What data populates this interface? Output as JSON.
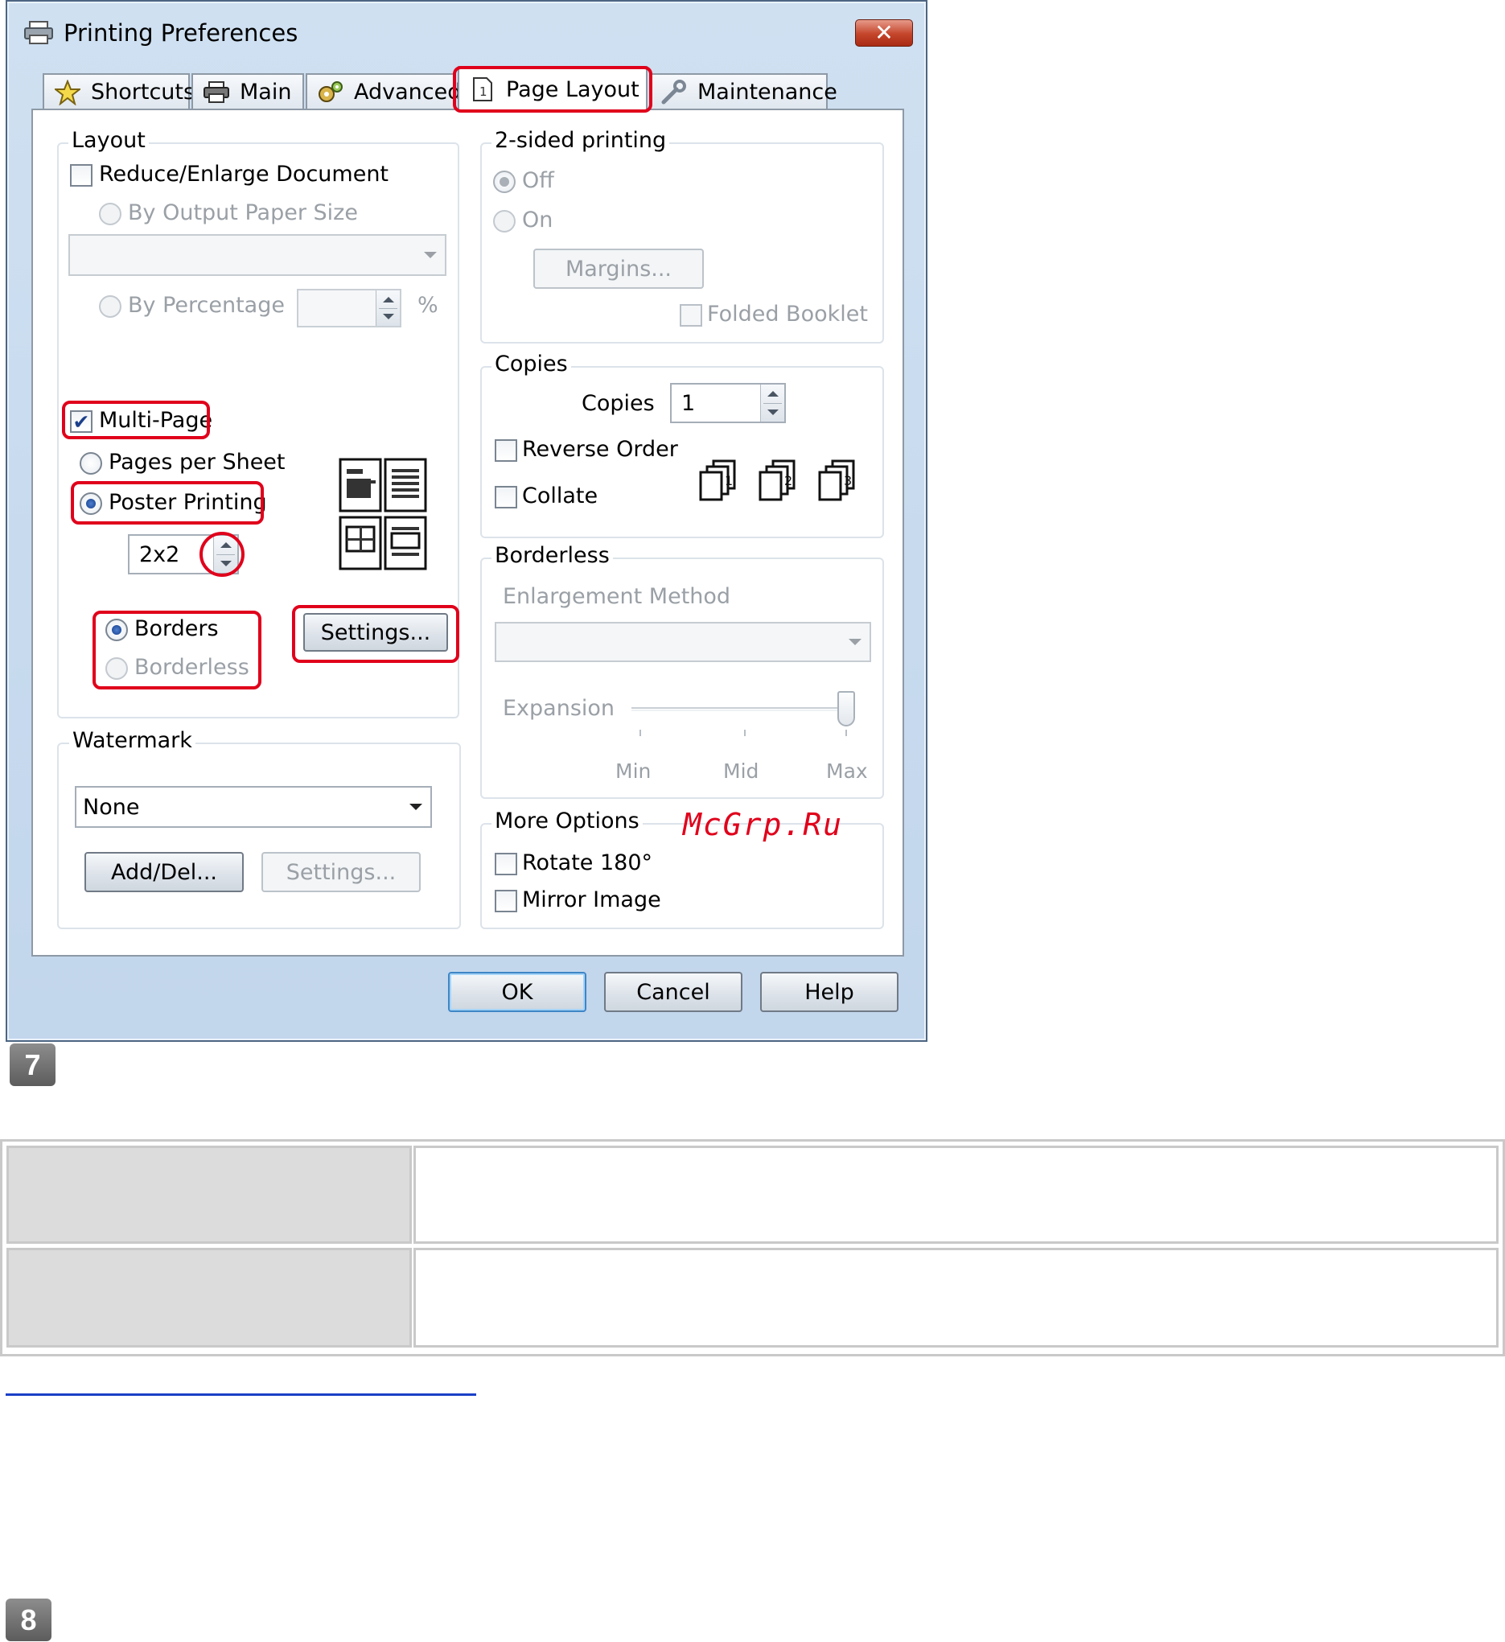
{
  "window": {
    "title": "Printing Preferences",
    "close_glyph": "✕"
  },
  "tabs": [
    {
      "label": "Shortcuts",
      "icon": "star-icon"
    },
    {
      "label": "Main",
      "icon": "printer-icon"
    },
    {
      "label": "Advanced",
      "icon": "gears-icon"
    },
    {
      "label": "Page Layout",
      "icon": "page-icon",
      "active": true
    },
    {
      "label": "Maintenance",
      "icon": "wrench-icon"
    }
  ],
  "layout": {
    "title": "Layout",
    "reduce_enlarge": {
      "label": "Reduce/Enlarge Document",
      "checked": false
    },
    "by_output_paper_size": {
      "label": "By Output Paper Size",
      "enabled": false
    },
    "paper_size_value": "",
    "by_percentage": {
      "label": "By Percentage",
      "enabled": false
    },
    "percentage_value": "",
    "percent_unit": "%",
    "multi_page": {
      "label": "Multi-Page",
      "checked": true
    },
    "pages_per_sheet": {
      "label": "Pages per Sheet",
      "selected": false
    },
    "poster_printing": {
      "label": "Poster Printing",
      "selected": true
    },
    "poster_value": "2x2",
    "borders": {
      "label": "Borders",
      "selected": true
    },
    "borderless": {
      "label": "Borderless",
      "selected": false,
      "enabled": false
    },
    "settings_button": "Settings..."
  },
  "two_sided": {
    "title": "2-sided printing",
    "off": {
      "label": "Off",
      "selected": true,
      "enabled": false
    },
    "on": {
      "label": "On",
      "selected": false,
      "enabled": false
    },
    "margins_button": "Margins...",
    "folded_booklet": {
      "label": "Folded Booklet",
      "checked": false,
      "enabled": false
    }
  },
  "copies": {
    "title": "Copies",
    "copies_label": "Copies",
    "copies_value": "1",
    "reverse_order": {
      "label": "Reverse Order",
      "checked": false
    },
    "collate": {
      "label": "Collate",
      "checked": false
    },
    "collate_icons": [
      "1",
      "2",
      "3"
    ]
  },
  "borderless": {
    "title": "Borderless",
    "enlargement_method_label": "Enlargement Method",
    "enlargement_value": "",
    "expansion_label": "Expansion",
    "slider_level": 1.0,
    "tick_labels": [
      "Min",
      "Mid",
      "Max"
    ]
  },
  "watermark": {
    "title": "Watermark",
    "value": "None",
    "add_del_button": "Add/Del...",
    "settings_button": "Settings..."
  },
  "more_options": {
    "title": "More Options",
    "rotate": {
      "label": "Rotate 180°",
      "checked": false
    },
    "mirror": {
      "label": "Mirror Image",
      "checked": false
    }
  },
  "footer_buttons": {
    "ok": "OK",
    "cancel": "Cancel",
    "help": "Help"
  },
  "overlay_watermark": "McGrp.Ru",
  "steps": {
    "step7": "7",
    "step8": "8"
  },
  "colors": {
    "highlight": "#e0001b",
    "link_rule": "#1a3fc6"
  }
}
